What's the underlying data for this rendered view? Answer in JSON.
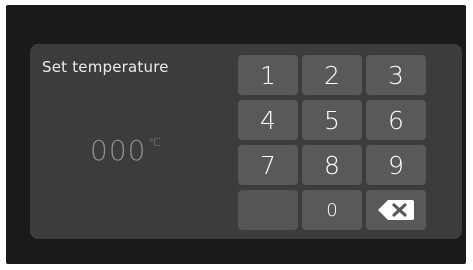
{
  "dialog": {
    "title": "Set temperature",
    "value": "000",
    "unit": "℃"
  },
  "keypad": {
    "keys": [
      "1",
      "2",
      "3",
      "4",
      "5",
      "6",
      "7",
      "8",
      "9",
      "",
      "0"
    ],
    "backspace_icon": "backspace-icon"
  },
  "colors": {
    "background": "#1a1a1a",
    "panel": "#3c3c3c",
    "key": "#595959",
    "key_text": "#ffffff",
    "readout_text": "#8e8e8e"
  }
}
